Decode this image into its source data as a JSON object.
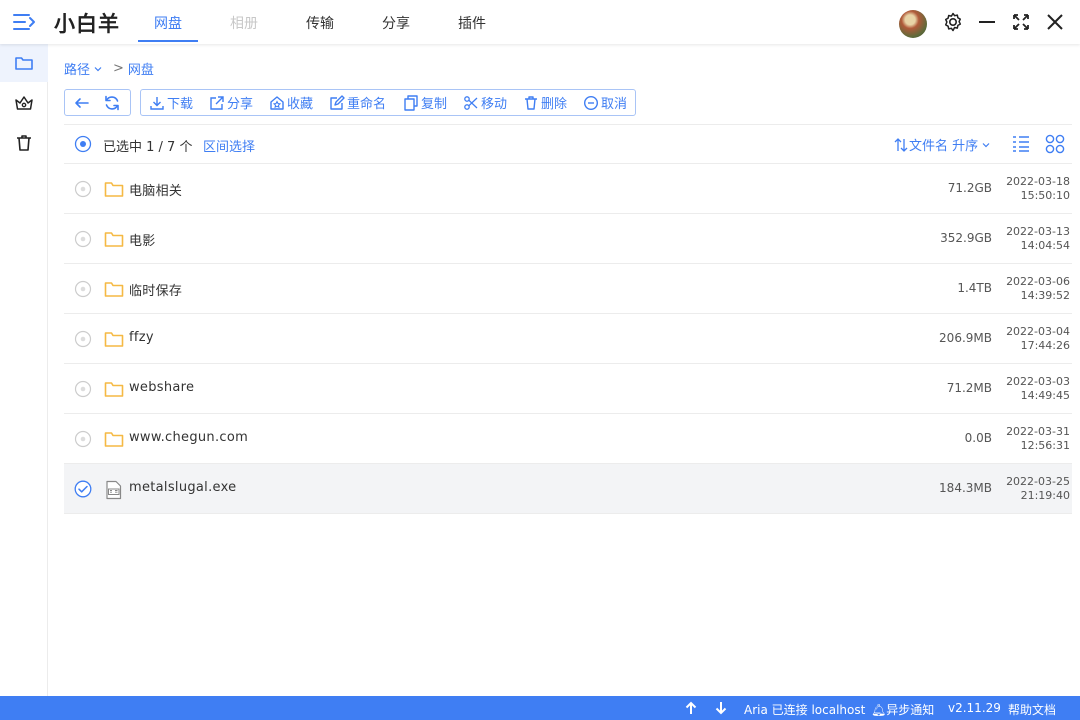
{
  "app": {
    "title": "小白羊"
  },
  "tabs": [
    {
      "label": "网盘",
      "state": "active"
    },
    {
      "label": "相册",
      "state": "disabled"
    },
    {
      "label": "传输",
      "state": "normal"
    },
    {
      "label": "分享",
      "state": "normal"
    },
    {
      "label": "插件",
      "state": "normal"
    }
  ],
  "sidebar": {
    "items": [
      {
        "icon": "folder-icon",
        "active": true
      },
      {
        "icon": "crown-icon",
        "active": false
      },
      {
        "icon": "trash-icon",
        "active": false
      }
    ]
  },
  "breadcrumb": {
    "root": "路径",
    "separator": ">",
    "current": "网盘"
  },
  "toolbar": {
    "actions": [
      {
        "label": "下载",
        "icon": "download-icon"
      },
      {
        "label": "分享",
        "icon": "share-icon"
      },
      {
        "label": "收藏",
        "icon": "favorite-icon"
      },
      {
        "label": "重命名",
        "icon": "rename-icon"
      },
      {
        "label": "复制",
        "icon": "copy-icon"
      },
      {
        "label": "移动",
        "icon": "cut-icon"
      },
      {
        "label": "删除",
        "icon": "delete-icon"
      },
      {
        "label": "取消",
        "icon": "cancel-icon"
      }
    ]
  },
  "selection": {
    "text": "已选中 1 / 7 个",
    "range_label": "区间选择"
  },
  "sort": {
    "label": "文件名 升序"
  },
  "files": [
    {
      "name": "电脑相关",
      "size": "71.2GB",
      "date": "2022-03-18",
      "time": "15:50:10",
      "type": "folder",
      "selected": false
    },
    {
      "name": "电影",
      "size": "352.9GB",
      "date": "2022-03-13",
      "time": "14:04:54",
      "type": "folder",
      "selected": false
    },
    {
      "name": "临时保存",
      "size": "1.4TB",
      "date": "2022-03-06",
      "time": "14:39:52",
      "type": "folder",
      "selected": false
    },
    {
      "name": "ffzy",
      "size": "206.9MB",
      "date": "2022-03-04",
      "time": "17:44:26",
      "type": "folder",
      "selected": false
    },
    {
      "name": "webshare",
      "size": "71.2MB",
      "date": "2022-03-03",
      "time": "14:49:45",
      "type": "folder",
      "selected": false
    },
    {
      "name": "www.chegun.com",
      "size": "0.0B",
      "date": "2022-03-31",
      "time": "12:56:31",
      "type": "folder",
      "selected": false
    },
    {
      "name": "metalslugal.exe",
      "size": "184.3MB",
      "date": "2022-03-25",
      "time": "21:19:40",
      "type": "exe",
      "selected": true
    }
  ],
  "statusbar": {
    "aria": "Aria 已连接 localhost",
    "notify": "异步通知",
    "version": "v2.11.29",
    "help": "帮助文档"
  },
  "colors": {
    "accent": "#3f7ef3",
    "folder": "#f5b944",
    "selected_row": "#f3f4f6"
  }
}
